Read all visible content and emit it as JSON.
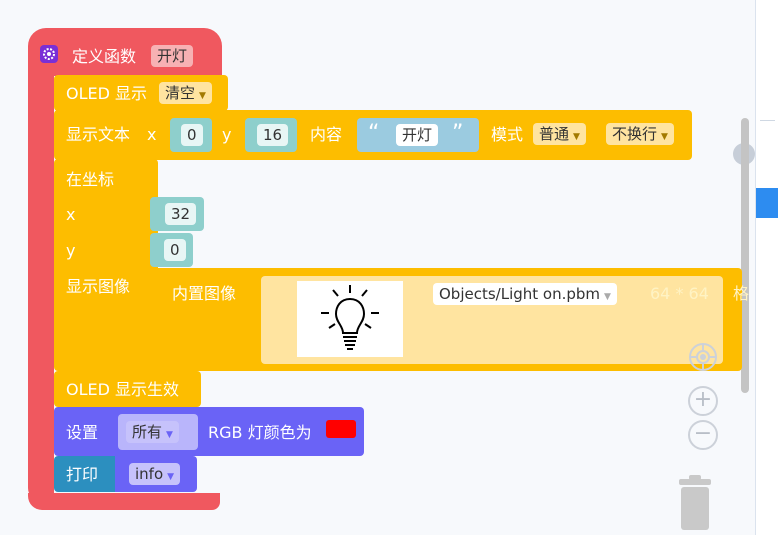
{
  "function_block": {
    "title": "定义函数",
    "name": "开灯"
  },
  "oled_clear": {
    "label": "OLED 显示",
    "mode": "清空"
  },
  "show_text": {
    "label": "显示文本",
    "x_label": "x",
    "x_value": "0",
    "y_label": "y",
    "y_value": "16",
    "content_label": "内容",
    "open_quote": "“",
    "text_value": "开灯",
    "close_quote": "”",
    "mode_label": "模式",
    "mode_value": "普通",
    "wrap_value": "不换行"
  },
  "show_image": {
    "at_label": "在坐标",
    "x_label": "x",
    "x_value": "32",
    "y_label": "y",
    "y_value": "0",
    "image_label": "显示图像",
    "builtin_label": "内置图像",
    "file_value": "Objects/Light on.pbm",
    "size_text": "64 * 64",
    "cut_text": "格"
  },
  "oled_apply": {
    "label": "OLED 显示生效"
  },
  "rgb_set": {
    "label_set": "设置",
    "target": "所有",
    "label_color": "RGB 灯颜色为",
    "color": "#ff0000"
  },
  "print_block": {
    "label": "打印",
    "value": "info"
  },
  "workspace_controls": {
    "zoom_in": "+",
    "zoom_out": "−",
    "collapse": "›"
  }
}
